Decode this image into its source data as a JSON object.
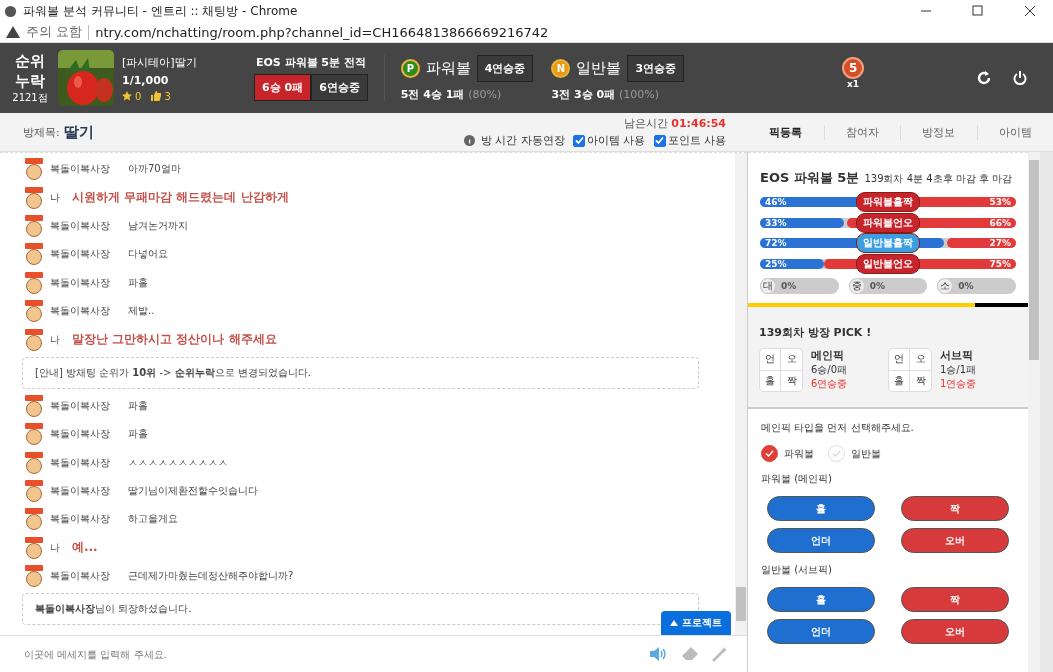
{
  "window": {
    "title": "파워볼 분석 커뮤니티 - 엔트리 :: 채팅방 - Chrome"
  },
  "address": {
    "warning": "주의 요함",
    "url": "ntry.com/nchatting/room.php?channel_id=CH1664813866669216742"
  },
  "header": {
    "rank": "순위 누락",
    "points": "2121점",
    "profile": {
      "name": "[파시테아]딸기",
      "count": "1/1,000",
      "stars": "0",
      "likes": "3"
    },
    "record": {
      "title": "EOS 파워볼 5분 전적",
      "result": "6승 0패",
      "streak": "6연승중"
    },
    "games": [
      {
        "badge": "P",
        "color": "#2e8b1e",
        "name": "파워볼",
        "streak": "4연승중",
        "summary": "5전 4승 1패",
        "rate": "(80%)"
      },
      {
        "badge": "N",
        "color": "#e79a12",
        "name": "일반볼",
        "streak": "3연승중",
        "summary": "3전 3승 0패",
        "rate": "(100%)"
      }
    ],
    "medal": {
      "number": "5",
      "count": "x1"
    }
  },
  "room": {
    "label": "방제목:",
    "title": "딸기",
    "time_label": "남은시간",
    "time": "01:46:54",
    "auto_extend": "방 시간 자동연장",
    "options": [
      {
        "label": "아이템 사용",
        "checked": true
      },
      {
        "label": "포인트 사용",
        "checked": true
      }
    ]
  },
  "tabs": [
    {
      "label": "픽등록",
      "selected": true
    },
    {
      "label": "참여자",
      "selected": false
    },
    {
      "label": "방정보",
      "selected": false
    },
    {
      "label": "아이템",
      "selected": false
    }
  ],
  "messages": [
    {
      "kind": "chat",
      "user": "복돌이복사장",
      "text": "아까70얼마"
    },
    {
      "kind": "mine",
      "user": "나",
      "text": "시원하게 무패마감 해드렸는데 난감하게"
    },
    {
      "kind": "chat",
      "user": "복돌이복사장",
      "text": "남겨논거까지"
    },
    {
      "kind": "chat",
      "user": "복돌이복사장",
      "text": "다넣어요"
    },
    {
      "kind": "chat",
      "user": "복돌이복사장",
      "text": "파홀"
    },
    {
      "kind": "chat",
      "user": "복돌이복사장",
      "text": "제발.."
    },
    {
      "kind": "mine",
      "user": "나",
      "text": "말장난 그만하시고 정산이나 해주세요"
    },
    {
      "kind": "notice",
      "text": "[안내] 방채팅 순위가 **10위** -> **순위누락**으로 변경되었습니다."
    },
    {
      "kind": "chat",
      "user": "복돌이복사장",
      "text": "파홀"
    },
    {
      "kind": "chat",
      "user": "복돌이복사장",
      "text": "파홀"
    },
    {
      "kind": "chat",
      "user": "복돌이복사장",
      "text": "ㅅㅅㅅㅅㅅㅅㅅㅅㅅㅅ"
    },
    {
      "kind": "chat",
      "user": "복돌이복사장",
      "text": "딸기님이제환전할수잇습니다"
    },
    {
      "kind": "chat",
      "user": "복돌이복사장",
      "text": "하고올게요"
    },
    {
      "kind": "mine",
      "user": "나",
      "text": "예..."
    },
    {
      "kind": "chat",
      "user": "복돌이복사장",
      "text": "근데제가마췄는데정산해주야합니까?"
    },
    {
      "kind": "notice",
      "text": "**복돌이복사장**님이 퇴장하셨습니다."
    }
  ],
  "protect_button": "프로젝트",
  "input": {
    "placeholder": "이곳에 메세지를 입력해 주세요."
  },
  "panel": {
    "title": "EOS 파워볼 5분",
    "subtitle": "139회차 4분 4초후 마감 후 마감",
    "bars": [
      {
        "label": "파워볼홀짝",
        "color": "#c8242b",
        "left": {
          "reading": "46%",
          "level": 0.46
        },
        "right": {
          "reading": "53%",
          "level": 0.53
        }
      },
      {
        "label": "파워볼언오",
        "color": "#c8242b",
        "left": {
          "reading": "33%",
          "level": 0.33
        },
        "right": {
          "reading": "66%",
          "level": 0.66
        }
      },
      {
        "label": "일반볼홀짝",
        "color": "#3d9ee0",
        "left": {
          "reading": "72%",
          "level": 0.72
        },
        "right": {
          "reading": "27%",
          "level": 0.27
        }
      },
      {
        "label": "일반볼언오",
        "color": "#c8242b",
        "left": {
          "reading": "25%",
          "level": 0.25
        },
        "right": {
          "reading": "75%",
          "level": 0.75
        }
      }
    ],
    "sizes": [
      {
        "glyph": "대",
        "reading": "0%",
        "level": 0
      },
      {
        "glyph": "중",
        "reading": "0%",
        "level": 0
      },
      {
        "glyph": "소",
        "reading": "0%",
        "level": 0
      }
    ],
    "timer": {
      "level": 0.81
    },
    "pick_title": "139회차 방장 PICK !",
    "picks": [
      {
        "cells": [
          "언",
          "오",
          "홀",
          "짝"
        ],
        "name": "메인픽",
        "record": "6승/0패",
        "streak": "6연승중"
      },
      {
        "cells": [
          "언",
          "오",
          "홀",
          "짝"
        ],
        "name": "서브픽",
        "record": "1승/1패",
        "streak": "1연승중"
      }
    ],
    "prompt": "메인픽 타입을 먼저 선택해주세요.",
    "types": [
      {
        "label": "파워볼",
        "selected": true
      },
      {
        "label": "일반볼",
        "selected": false
      }
    ],
    "sections": [
      {
        "title": "파워볼 (메인픽)",
        "buttons": [
          {
            "label": "홀",
            "color": "#1f6fd0"
          },
          {
            "label": "짝",
            "color": "#d63a3a"
          },
          {
            "label": "언더",
            "color": "#1f6fd0"
          },
          {
            "label": "오버",
            "color": "#d63a3a"
          }
        ]
      },
      {
        "title": "일반볼 (서브픽)",
        "buttons": [
          {
            "label": "홀",
            "color": "#1f6fd0"
          },
          {
            "label": "짝",
            "color": "#d63a3a"
          },
          {
            "label": "언더",
            "color": "#1f6fd0"
          },
          {
            "label": "오버",
            "color": "#d63a3a"
          }
        ]
      }
    ]
  }
}
